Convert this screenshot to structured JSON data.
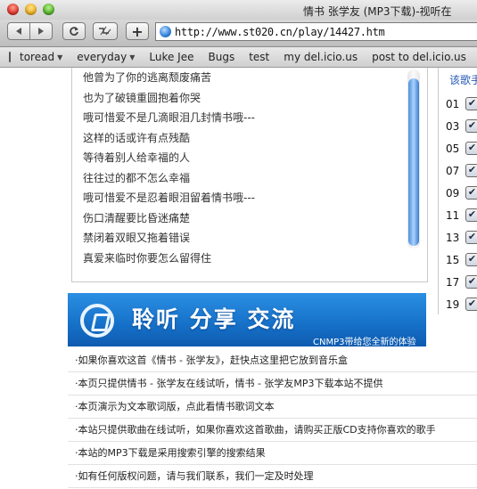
{
  "window": {
    "title": "情书 张学友 (MP3下载)-视听在"
  },
  "toolbar": {
    "back_icon": "arrow-left-icon",
    "forward_icon": "arrow-right-icon",
    "reload_icon": "reload-icon",
    "snapback_icon": "snapback-icon",
    "add_bookmark_label": "+",
    "url": "http://www.st020.cn/play/14427.htm"
  },
  "bookmarks": [
    {
      "label": "toread",
      "dropdown": true
    },
    {
      "label": "everyday",
      "dropdown": true
    },
    {
      "label": "Luke Jee",
      "dropdown": false
    },
    {
      "label": "Bugs",
      "dropdown": false
    },
    {
      "label": "test",
      "dropdown": false
    },
    {
      "label": "my del.icio.us",
      "dropdown": false
    },
    {
      "label": "post to del.icio.us",
      "dropdown": false
    }
  ],
  "lyrics": [
    "他曾为了你的逃离颓废痛苦",
    "也为了破镜重圆抱着你哭",
    "哦可惜爱不是几滴眼泪几封情书哦---",
    "这样的话或许有点残酷",
    "等待着别人给幸福的人",
    "往往过的都不怎么幸福",
    "哦可惜爱不是忍着眼泪留着情书哦---",
    "伤口清醒要比昏迷痛楚",
    "禁闭着双眼又拖着错误",
    "真爱来临时你要怎么留得住"
  ],
  "sidebar": {
    "heading": "该歌手",
    "numbers": [
      "01",
      "03",
      "05",
      "07",
      "09",
      "11",
      "13",
      "15",
      "17",
      "19"
    ],
    "checked": true
  },
  "banner": {
    "slogan": "聆听  分享  交流",
    "note": "CNMP3带给您全新的体验"
  },
  "info": [
    "·如果你喜欢这首《情书 - 张学友》，赶快点这里把它放到音乐盒",
    "·本页只提供情书 - 张学友在线试听，情书 - 张学友MP3下载本站不提供",
    "·本页演示为文本歌词版，点此看情书歌词文本",
    "·本站只提供歌曲在线试听，如果你喜欢这首歌曲，请购买正版CD支持你喜欢的歌手",
    "·本站的MP3下载是采用搜索引擎的搜索结果",
    "·如有任何版权问题，请与我们联系，我们一定及时处理"
  ],
  "colors": {
    "banner_blue": "#1670c8",
    "link_blue": "#2559b6"
  }
}
